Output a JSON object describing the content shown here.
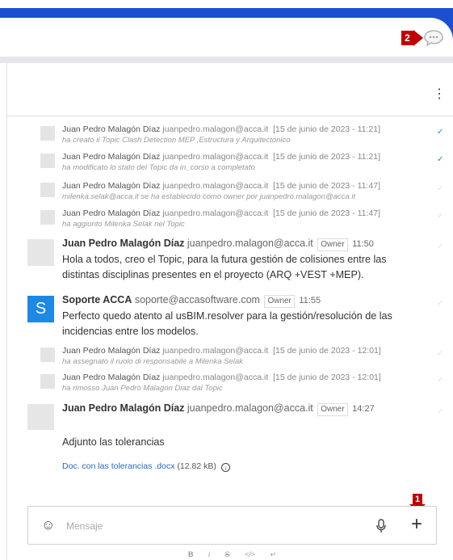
{
  "markers": {
    "one": "1",
    "two": "2"
  },
  "system_messages_top": [
    {
      "name": "Juan Pedro Malagón Díaz",
      "email": "juanpedro.malagon@acca.it",
      "date": "[15 de junio de 2023 - 11:21]",
      "detail": "ha creato il Topic Clash Detection MEP ,Estructura y Arquitectónico"
    },
    {
      "name": "Juan Pedro Malagón Díaz",
      "email": "juanpedro.malagon@acca.it",
      "date": "[15 de junio de 2023 - 11:21]",
      "detail": "ha modificato lo stato del Topic da in_corso a completato"
    },
    {
      "name": "Juan Pedro Malagón Díaz",
      "email": "juanpedro.malagon@acca.it",
      "date": "[15 de junio de 2023 - 11:47]",
      "detail": "milenka.selak@acca.it se ha establecido como owner por juanpedro.malagon@acca.it"
    },
    {
      "name": "Juan Pedro Malagón Díaz",
      "email": "juanpedro.malagon@acca.it",
      "date": "[15 de junio de 2023 - 11:47]",
      "detail": "ha aggiunto Milenka Selak nel Topic"
    }
  ],
  "message_1": {
    "name": "Juan Pedro Malagón Díaz",
    "email": "juanpedro.malagon@acca.it",
    "badge": "Owner",
    "time": "11:50",
    "body": "Hola a todos, creo el Topic, para la futura gestión de colisiones entre las distintas disciplinas presentes en el proyecto (ARQ +VEST +MEP)."
  },
  "message_2": {
    "avatar_letter": "S",
    "name": "Soporte ACCA",
    "email": "soporte@accasoftware.com",
    "badge": "Owner",
    "time": "11:55",
    "body": "Perfecto quedo atento al usBIM.resolver para la gestión/resolución de las incidencias entre los modelos."
  },
  "system_messages_bottom": [
    {
      "name": "Juan Pedro Malagón Díaz",
      "email": "juanpedro.malagon@acca.it",
      "date": "[15 de junio de 2023 - 12:01]",
      "detail": "ha assegnato il ruolo di responsabile a Milenka Selak"
    },
    {
      "name": "Juan Pedro Malagón Díaz",
      "email": "juanpedro.malagon@acca.it",
      "date": "[15 de junio de 2023 - 12:01]",
      "detail": "ha rimosso Juan Pedro Malagon Diaz dal Topic"
    }
  ],
  "message_3": {
    "name": "Juan Pedro Malagón Díaz",
    "email": "juanpedro.malagon@acca.it",
    "badge": "Owner",
    "time": "14:27",
    "body": "Adjunto las tolerancias"
  },
  "attachment": {
    "file_name": "Doc. con las tolerancias .docx",
    "size": "(12.82 kB)"
  },
  "composer": {
    "placeholder": "Mensaje"
  },
  "format_toolbar": [
    "B",
    "i",
    "S",
    "</>",
    "↵"
  ]
}
